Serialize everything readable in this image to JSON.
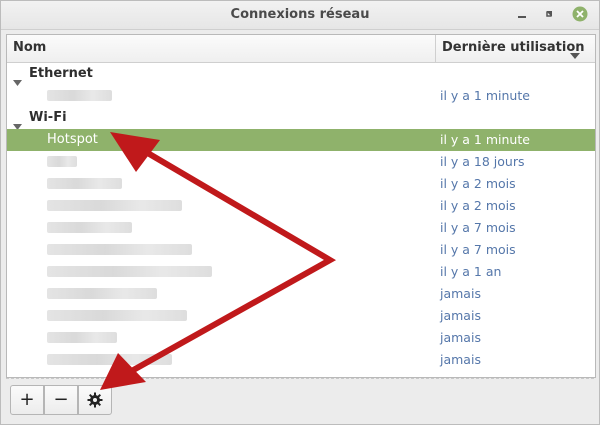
{
  "window": {
    "title": "Connexions réseau",
    "controls": [
      "minimize-icon",
      "maximize-icon",
      "close-icon"
    ],
    "close_color": "#8fb26b"
  },
  "table": {
    "columns": {
      "name": "Nom",
      "last_used": "Dernière utilisation"
    },
    "sort_indicator": "chevron-down-icon",
    "groups": [
      {
        "label": "Ethernet",
        "rows": [
          {
            "name": "",
            "last_used": "il y a 1 minute",
            "redacted": true
          }
        ]
      },
      {
        "label": "Wi-Fi",
        "rows": [
          {
            "name": "Hotspot",
            "last_used": "il y a 1 minute",
            "selected": true
          },
          {
            "name": "",
            "last_used": "il y a 18 jours",
            "redacted": true
          },
          {
            "name": "",
            "last_used": "il y a 2 mois",
            "redacted": true
          },
          {
            "name": "",
            "last_used": "il y a 2 mois",
            "redacted": true
          },
          {
            "name": "",
            "last_used": "il y a 7 mois",
            "redacted": true
          },
          {
            "name": "",
            "last_used": "il y a 7 mois",
            "redacted": true
          },
          {
            "name": "",
            "last_used": "il y a 1 an",
            "redacted": true
          },
          {
            "name": "",
            "last_used": "jamais",
            "redacted": true
          },
          {
            "name": "",
            "last_used": "jamais",
            "redacted": true
          },
          {
            "name": "",
            "last_used": "jamais",
            "redacted": true
          },
          {
            "name": "",
            "last_used": "jamais",
            "redacted": true
          }
        ]
      }
    ]
  },
  "toolbar": {
    "add_label": "+",
    "remove_label": "−",
    "settings_icon": "gear-icon"
  },
  "annotation": {
    "color": "#c0191b"
  }
}
